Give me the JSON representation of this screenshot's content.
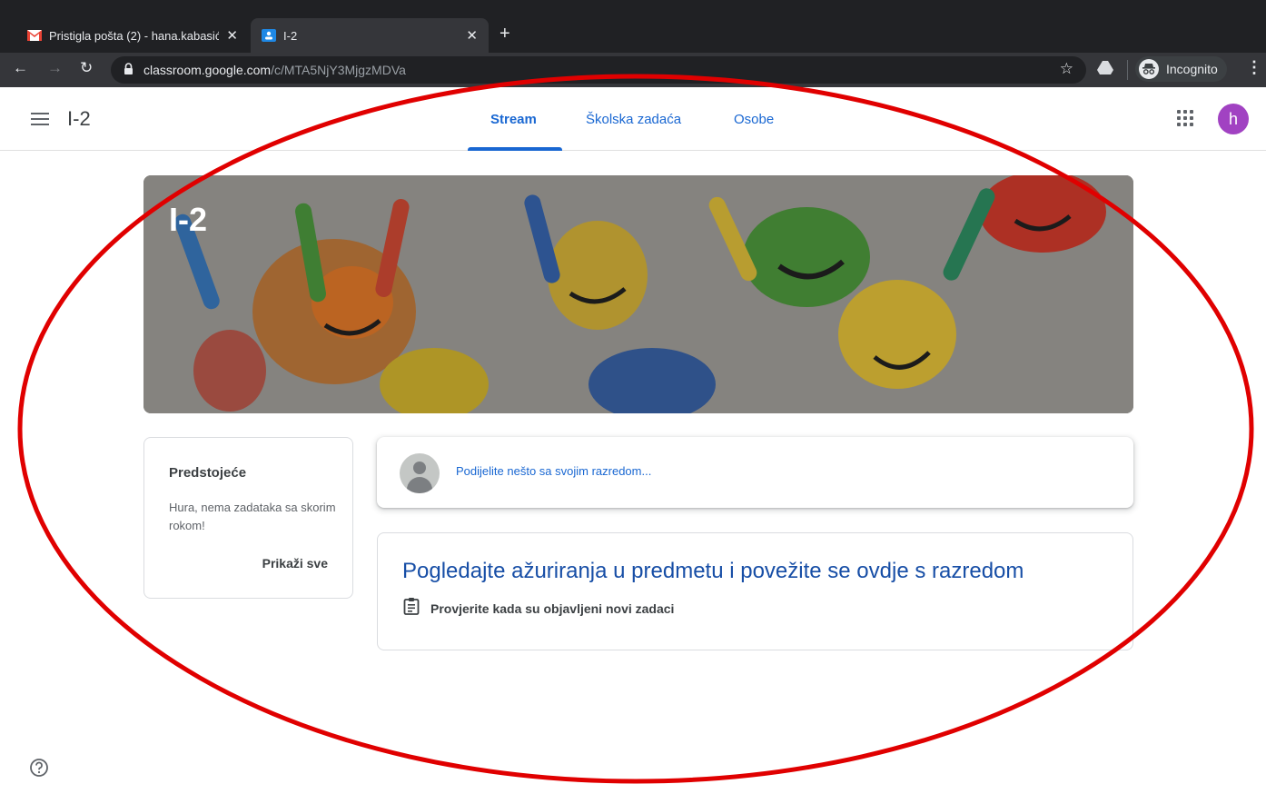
{
  "browser": {
    "tabs": [
      {
        "title": "Pristigla pošta (2) - hana.kabasić",
        "icon": "gmail-icon",
        "active": false
      },
      {
        "title": "I-2",
        "icon": "classroom-icon",
        "active": true
      }
    ],
    "url_host": "classroom.google.com",
    "url_path": "/c/MTA5NjY3MjgzMDVa",
    "incognito_label": "Incognito"
  },
  "header": {
    "class_name": "I-2",
    "tabs": [
      {
        "label": "Stream",
        "active": true
      },
      {
        "label": "Školska zadaća",
        "active": false
      },
      {
        "label": "Osobe",
        "active": false
      }
    ],
    "avatar_letter": "h",
    "avatar_color": "#a142c2"
  },
  "banner": {
    "title": "I-2"
  },
  "upcoming": {
    "heading": "Predstojeće",
    "message": "Hura, nema zadataka sa skorim rokom!",
    "view_all": "Prikaži sve"
  },
  "share": {
    "prompt": "Podijelite nešto sa svojim razredom..."
  },
  "info": {
    "heading": "Pogledajte ažuriranja u predmetu i povežite se ovdje s razredom",
    "line": "Provjerite kada su objavljeni novi zadaci"
  },
  "colors": {
    "accent": "#1967d2",
    "annotation": "#e00000",
    "chrome_dark": "#202124"
  }
}
